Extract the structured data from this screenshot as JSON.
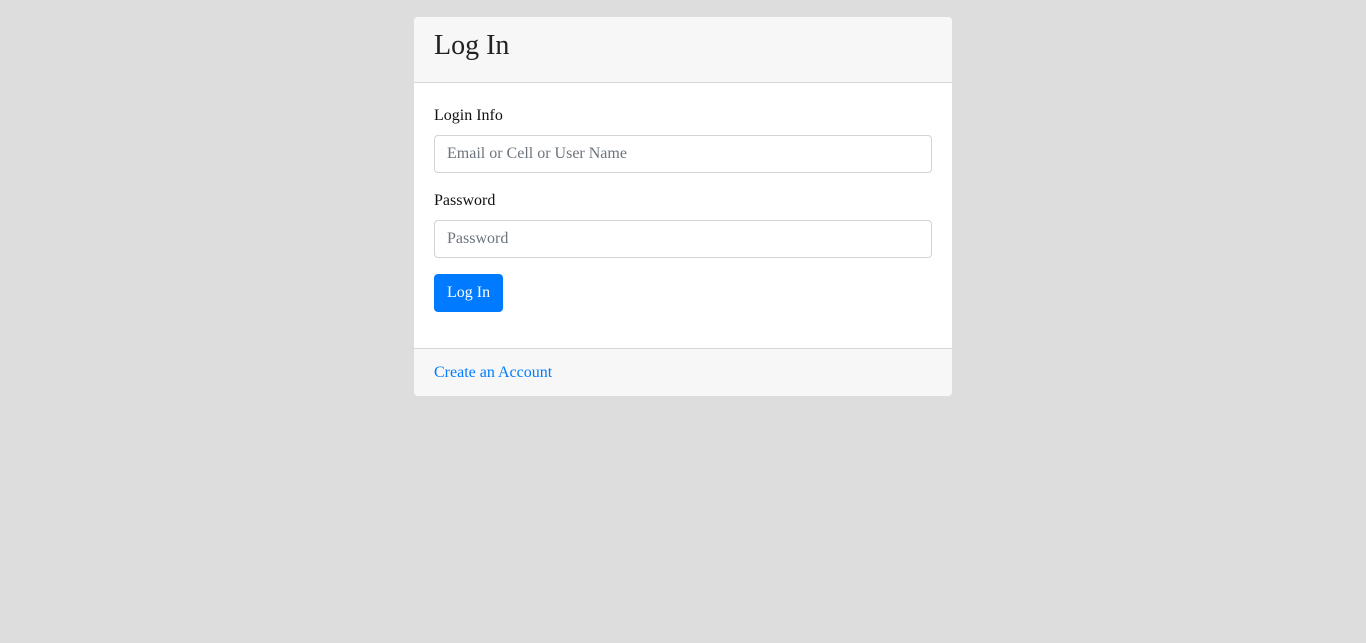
{
  "login_card": {
    "title": "Log In",
    "login_info": {
      "label": "Login Info",
      "value": "",
      "placeholder": "Email or Cell or User Name"
    },
    "password": {
      "label": "Password",
      "value": "",
      "placeholder": "Password"
    },
    "submit_label": "Log In",
    "footer_link": "Create an Account"
  },
  "colors": {
    "page_background": "#dddddd",
    "card_header_background": "#f7f7f7",
    "primary": "#007bff"
  }
}
